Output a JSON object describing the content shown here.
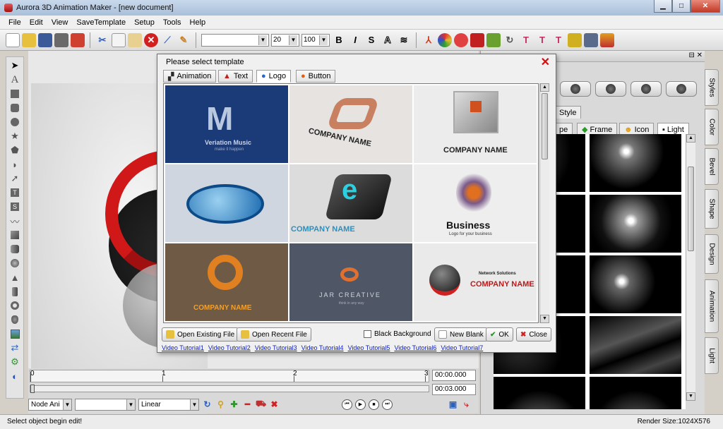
{
  "window": {
    "title": "Aurora 3D Animation Maker - [new document]",
    "minimize_symbol": "▁",
    "maximize_symbol": "□",
    "close_symbol": "✕"
  },
  "menu": [
    "File",
    "Edit",
    "View",
    "SaveTemplate",
    "Setup",
    "Tools",
    "Help"
  ],
  "toolbar": {
    "font_size": "20",
    "scale": "100",
    "bold": "B",
    "italic": "I",
    "strike": "S",
    "outline": "A",
    "icons": [
      "new-icon",
      "open-icon",
      "save-icon",
      "save-as-icon",
      "export-icon",
      "cut-icon",
      "copy-icon",
      "paste-icon",
      "delete-icon",
      "clear-icon",
      "paint-icon"
    ]
  },
  "left_tools": [
    "arrow-icon",
    "text-icon",
    "rectangle-icon",
    "rounded-rect-icon",
    "circle-icon",
    "star-icon",
    "pentagon-icon",
    "shape-icon",
    "arrow-shape-icon",
    "text-box-icon",
    "s-shape-icon",
    "wave-icon",
    "cube-icon",
    "cylinder-icon",
    "sphere-icon",
    "cone-icon",
    "tube-icon",
    "torus-icon",
    "hat-icon",
    "image-icon",
    "script-icon",
    "link-icon",
    "logo-icon"
  ],
  "dialog": {
    "title": "Please select template",
    "close_symbol": "✕",
    "tabs": [
      {
        "label": "Animation",
        "active": false,
        "color": "#2a2a2a"
      },
      {
        "label": "Text",
        "active": false,
        "color": "#c02020"
      },
      {
        "label": "Logo",
        "active": true,
        "color": "#2a66cc"
      },
      {
        "label": "Button",
        "active": false,
        "color": "#e06010"
      }
    ],
    "templates": [
      {
        "caption": "Veriation Music",
        "subcaption": "make it happen",
        "bg": "#1b3a78"
      },
      {
        "caption": "COMPANY NAME",
        "bg": "#e6e3e0"
      },
      {
        "caption": "COMPANY NAME",
        "bg": "#ececec"
      },
      {
        "caption": "",
        "bg": "#cfd6df"
      },
      {
        "caption": "COMPANY NAME",
        "bg": "#dcdcdc"
      },
      {
        "caption": "Business",
        "subcaption": "Logo for your business",
        "bg": "#eeeeee"
      },
      {
        "caption": "COMPANY NAME",
        "bg": "#6e5a45"
      },
      {
        "caption": "JAR CREATIVE",
        "subcaption": "think in any way",
        "bg": "#4f5766"
      },
      {
        "caption": "COMPANY NAME",
        "subcaption": "Network Solutions",
        "bg": "#eaeaea"
      }
    ],
    "buttons": {
      "open_existing": "Open Existing File",
      "open_recent": "Open Recent File",
      "black_background": "Black Background",
      "new_blank": "New Blank",
      "ok": "OK",
      "close": "Close"
    },
    "tutorials": [
      "Video Tutorial1",
      "Video Tutorial2",
      "Video Tutorial3",
      "Video Tutorial4",
      "Video Tutorial5",
      "Video Tutorial6",
      "Video Tutorial7"
    ]
  },
  "right_panel": {
    "style_tab": "Style",
    "tabs": [
      {
        "label": "pe"
      },
      {
        "label": "Frame"
      },
      {
        "label": "Icon"
      },
      {
        "label": "Light"
      }
    ]
  },
  "side_tabs": [
    "Styles",
    "Color",
    "Bevel",
    "Shape",
    "Design",
    "Animation",
    "Light"
  ],
  "timeline": {
    "ticks": [
      "0",
      "1",
      "2",
      "3"
    ],
    "current_time": "00:00.000",
    "total_time": "00:03.000",
    "node_mode": "Node Ani",
    "interpolation": "Linear"
  },
  "status": {
    "message": "Select object begin edit!",
    "render_size": "Render Size:1024X576"
  }
}
